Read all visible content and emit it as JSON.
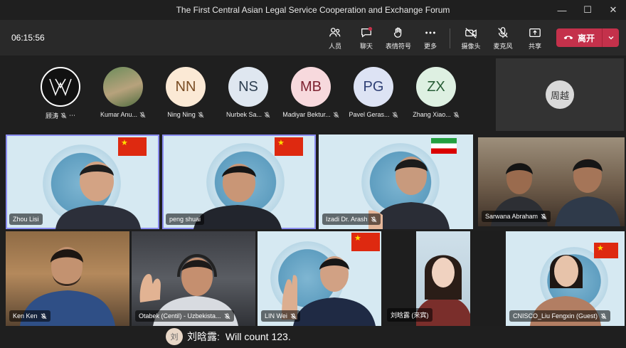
{
  "window": {
    "title": "The First Central Asian Legal Service Cooperation and Exchange Forum"
  },
  "toolbar": {
    "timer": "06:15:56",
    "people": "人员",
    "chat": "聊天",
    "reactions": "表情符号",
    "more": "更多",
    "camera": "摄像头",
    "mic": "麦克风",
    "share": "共享",
    "leave": "离开"
  },
  "participants": [
    {
      "name": "顾涛",
      "avatar": ""
    },
    {
      "name": "Kumar Anu...",
      "avatar": ""
    },
    {
      "name": "Ning Ning",
      "avatar": "NN"
    },
    {
      "name": "Nurbek Sa...",
      "avatar": "NS"
    },
    {
      "name": "Madiyar Bektur...",
      "avatar": "MB"
    },
    {
      "name": "Pavel Geras...",
      "avatar": "PG"
    },
    {
      "name": "Zhang Xiao...",
      "avatar": "ZX"
    }
  ],
  "overflow": {
    "avatar": "周越"
  },
  "videos": [
    {
      "name": "Zhou Lisi"
    },
    {
      "name": "peng shuai"
    },
    {
      "name": "Izadi Dr. Arash"
    },
    {
      "name": "Sarwana Abraham"
    },
    {
      "name": "Ken Ken"
    },
    {
      "name": "Otabek (Centil) - Uzbekista..."
    },
    {
      "name": "LIN Wei"
    },
    {
      "name": "刘晗露 (来宾)"
    },
    {
      "name": "CNISCO_Liu Fengxin (Guest)"
    }
  ],
  "subtitle": {
    "avatar": "刘",
    "speaker": "刘晗露:",
    "text": "Will count 123."
  }
}
